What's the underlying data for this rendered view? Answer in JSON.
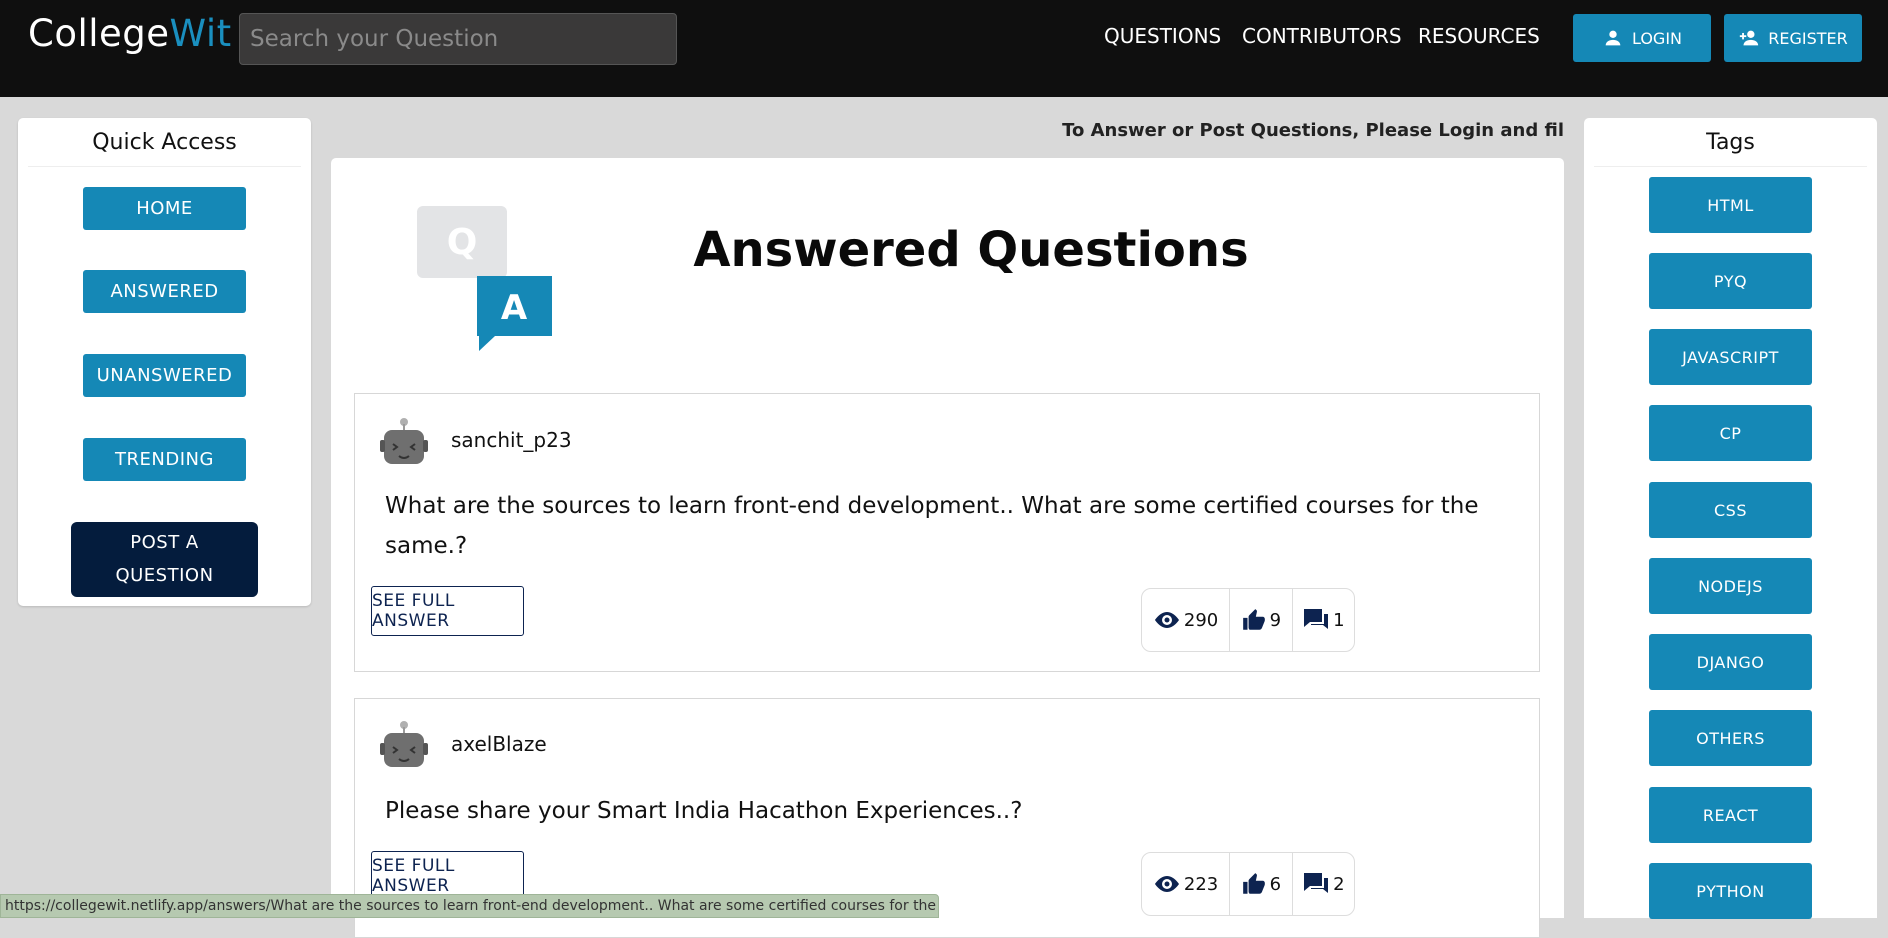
{
  "header": {
    "logo_part1": "College",
    "logo_part2": "Wit",
    "search_placeholder": "Search your Question",
    "nav": [
      "QUESTIONS",
      "CONTRIBUTORS",
      "RESOURCES"
    ],
    "login_label": "LOGIN",
    "register_label": "REGISTER",
    "login_icon": "person-icon",
    "register_icon": "person-add-icon"
  },
  "quick_access": {
    "title": "Quick Access",
    "items": [
      "HOME",
      "ANSWERED",
      "UNANSWERED",
      "TRENDING"
    ],
    "post_line1": "POST A",
    "post_line2": "QUESTION"
  },
  "notice": "To Answer or Post Questions, Please Login and fil",
  "main": {
    "title": "Answered Questions",
    "qa_icon_q": "Q",
    "qa_icon_a": "A",
    "cards": [
      {
        "user": "sanchit_p23",
        "question": "What are the sources to learn front-end development.. What are some certified courses for the same.?",
        "button": "SEE FULL ANSWER",
        "views": "290",
        "likes": "9",
        "comments": "1"
      },
      {
        "user": "axelBlaze",
        "question": "Please share your Smart India Hacathon Experiences..?",
        "button": "SEE FULL ANSWER",
        "views": "223",
        "likes": "6",
        "comments": "2"
      }
    ]
  },
  "tags": {
    "title": "Tags",
    "items": [
      "HTML",
      "PYQ",
      "JAVASCRIPT",
      "CP",
      "CSS",
      "NODEJS",
      "DJANGO",
      "OTHERS",
      "REACT",
      "PYTHON"
    ]
  },
  "status_url": "https://collegewit.netlify.app/answers/What are the sources to learn front-end development.. What are some certified courses for the same.?",
  "colors": {
    "navbar": "#0f0f0f",
    "accent": "#1588b6",
    "post_button": "#041c3d",
    "page_bg": "#d9d9d9"
  }
}
